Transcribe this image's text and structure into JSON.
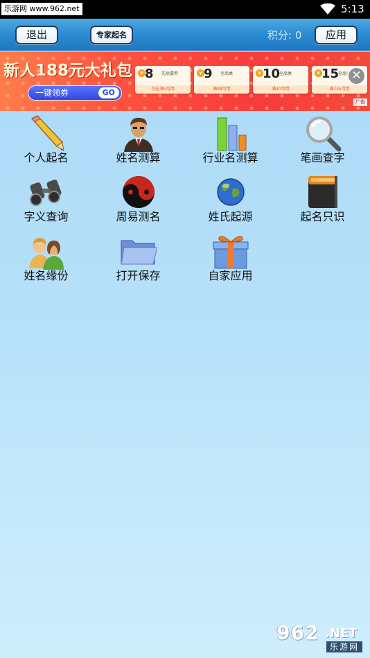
{
  "status_bar": {
    "site_tag": "乐游网 www.962.net",
    "time": "5:13"
  },
  "toolbar": {
    "exit_label": "退出",
    "expert_label": "专家起名",
    "points_text": "积分: 0",
    "apps_label": "应用"
  },
  "ad": {
    "headline": "新人188元大礼包",
    "cta_label": "一键领券",
    "cta_go": "GO",
    "ad_tag": "广告",
    "coupons": [
      {
        "currency": "¥",
        "value": "8",
        "name": "先后要券",
        "note": "可在满5可用"
      },
      {
        "currency": "¥",
        "value": "9",
        "name": "全品类",
        "note": "满88可用"
      },
      {
        "currency": "¥",
        "value": "10",
        "name": "全品类",
        "note": "满40可用"
      },
      {
        "currency": "¥",
        "value": "15",
        "name": "全品类",
        "note": "满235可用"
      }
    ]
  },
  "features": [
    {
      "label": "个人起名",
      "icon": "pencil-icon"
    },
    {
      "label": "姓名测算",
      "icon": "businessman-icon"
    },
    {
      "label": "行业名测算",
      "icon": "bar-chart-icon"
    },
    {
      "label": "笔画查字",
      "icon": "magnifier-icon"
    },
    {
      "label": "字义查询",
      "icon": "binoculars-icon"
    },
    {
      "label": "周易测名",
      "icon": "yin-yang-icon"
    },
    {
      "label": "姓氏起源",
      "icon": "globe-icon"
    },
    {
      "label": "起名只识",
      "icon": "book-icon"
    },
    {
      "label": "姓名缘份",
      "icon": "couple-icon"
    },
    {
      "label": "打开保存",
      "icon": "folder-icon"
    },
    {
      "label": "自家应用",
      "icon": "gift-icon"
    }
  ],
  "watermark": {
    "number": "962",
    "net": ".NET",
    "cn": "乐游网"
  },
  "colors": {
    "toolbar_blue": "#2b8bd0",
    "background_top": "#a9d8f6",
    "ad_red": "#f73c3c"
  }
}
